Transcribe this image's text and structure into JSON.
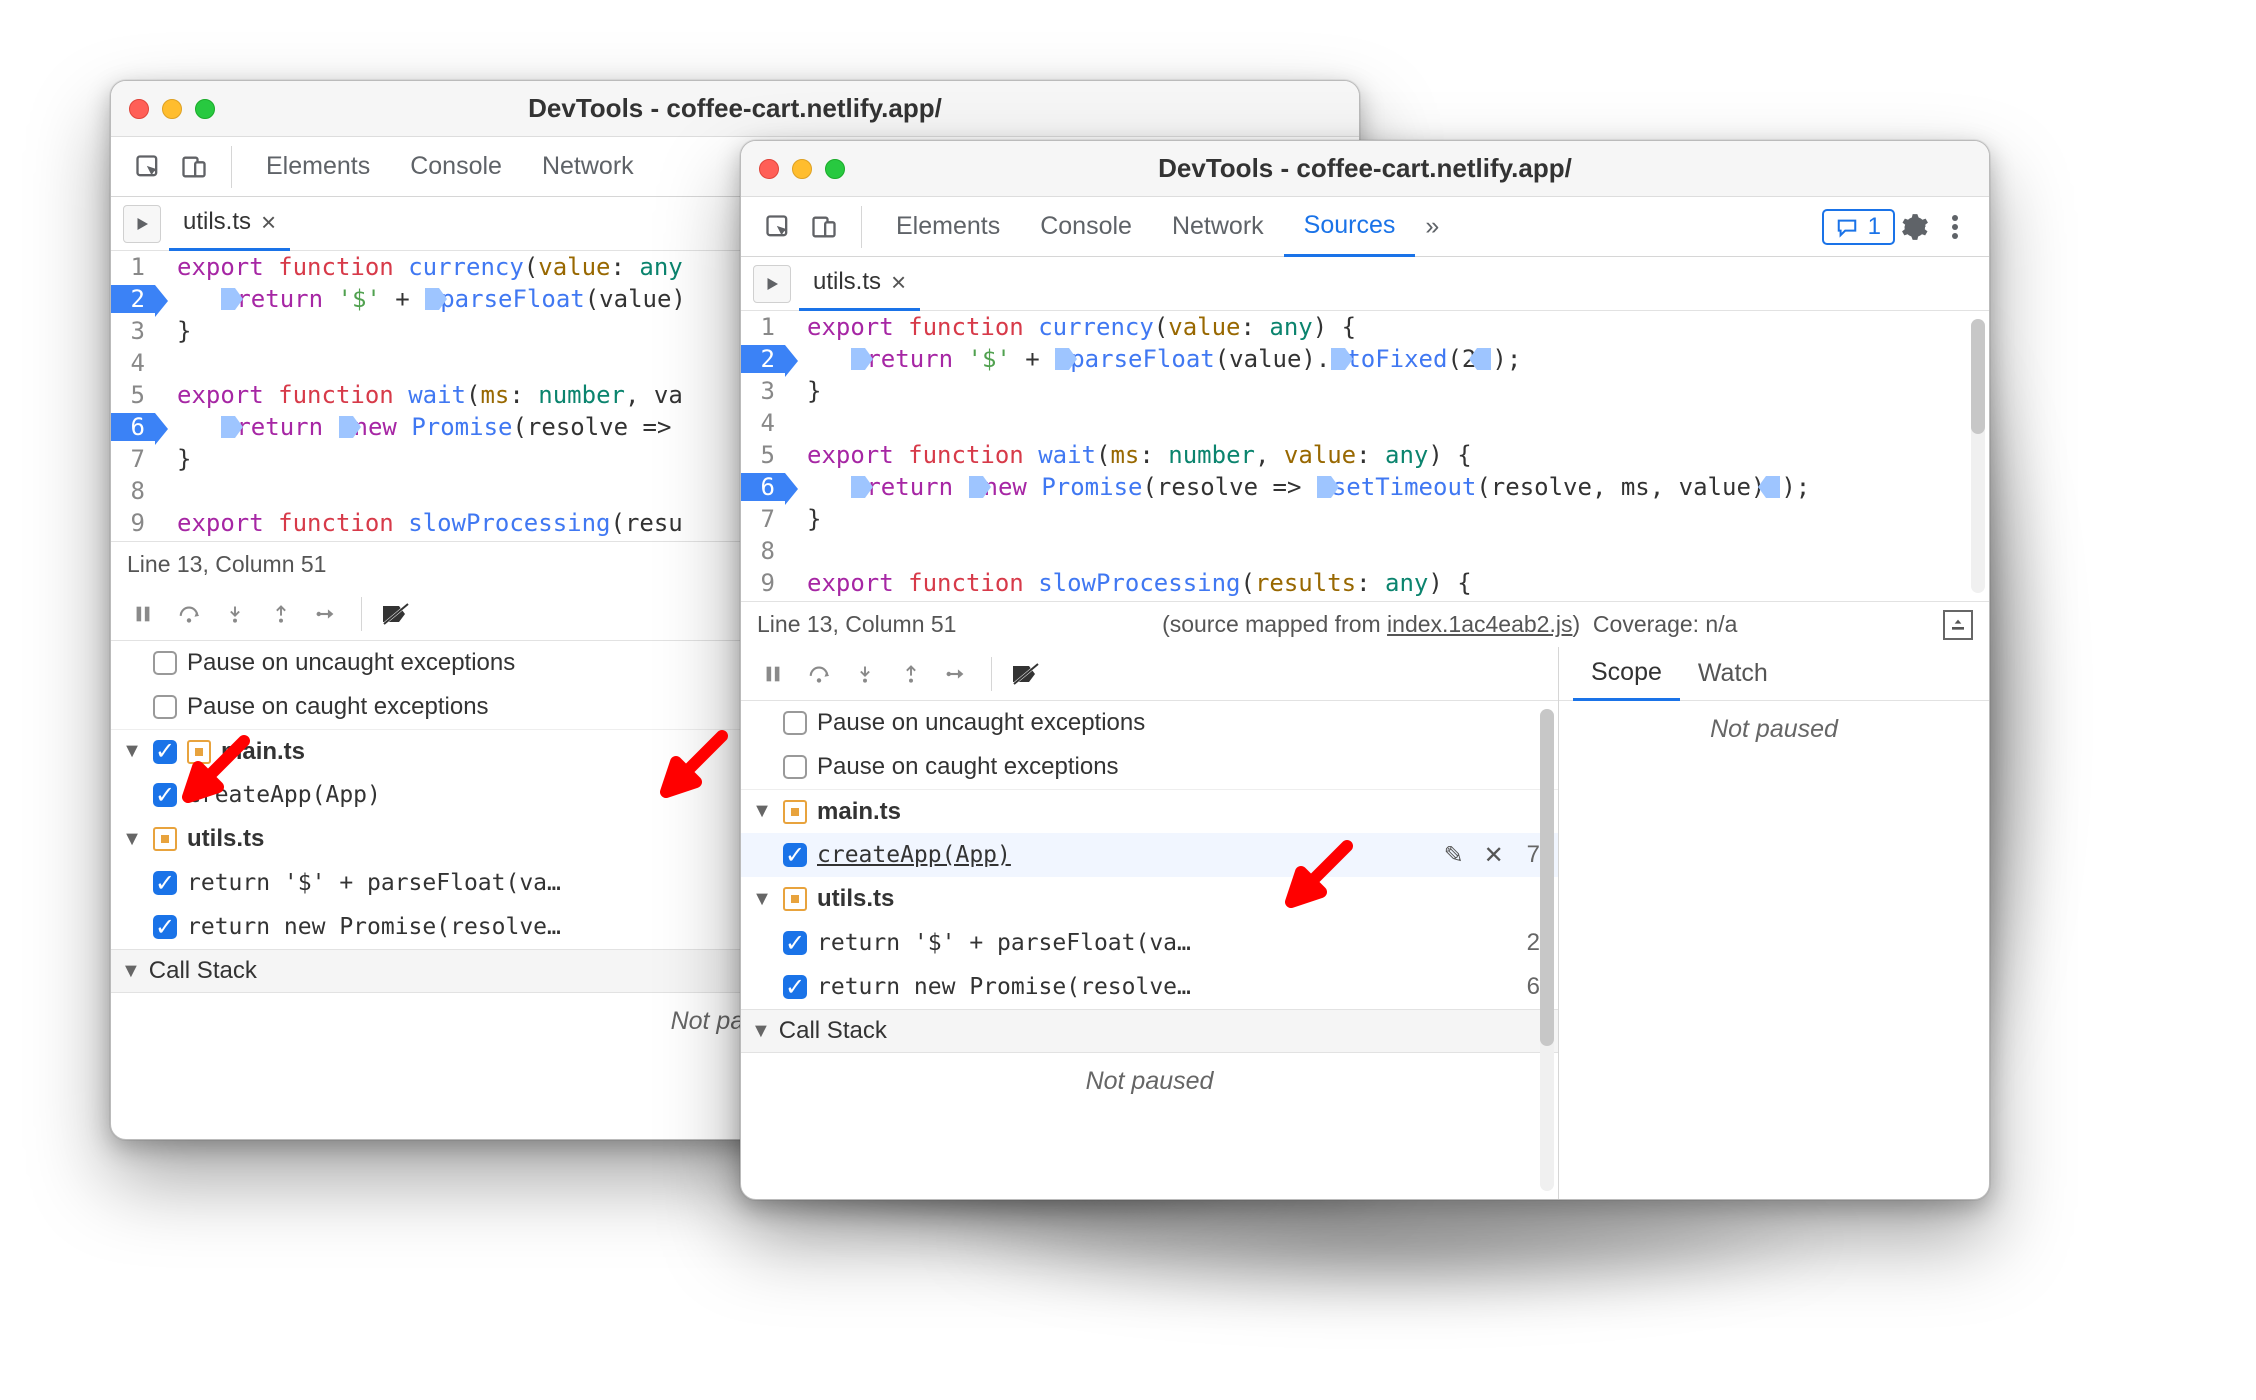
{
  "title": "DevTools - coffee-cart.netlify.app/",
  "tabs": [
    "Elements",
    "Console",
    "Network",
    "Sources"
  ],
  "issues_count": "1",
  "file_tab": "utils.ts",
  "status": {
    "pos": "Line 13, Column 51",
    "mapped_prefix": "(source mapped from ",
    "mapped_file": "index.1ac4eab2.js",
    "mapped_suffix": ")",
    "coverage": "Coverage: n/a",
    "mapped_short": "(source mapped"
  },
  "code": {
    "l1a": "export",
    "l1b": " function",
    "l1c": " currency",
    "l1d": "(",
    "l1e": "value",
    "l1f": ": ",
    "l1g": "any",
    "l1h": ") {",
    "l2a": "return",
    "l2b": " '$'",
    "l2c": " + ",
    "l2d": "parseFloat",
    "l2e": "(value).",
    "l2f": "toFixed",
    "l2g": "(",
    "l2h": "2",
    "l2i": ");",
    "l3": "}",
    "l5a": "export",
    "l5b": " function",
    "l5c": " wait",
    "l5d": "(",
    "l5e": "ms",
    "l5f": ": ",
    "l5g": "number",
    "l5h": ", ",
    "l5i": "value",
    "l5j": ": ",
    "l5k": "any",
    "l5l": ") {",
    "l6a": "return",
    "l6b": "new",
    "l6c": " Promise",
    "l6d": "(resolve => ",
    "l6e": "setTimeout",
    "l6f": "(resolve, ms, value)",
    "l6g": ");",
    "l7": "}",
    "l9a": "export",
    "l9b": " function",
    "l9c": " slowProcessing",
    "l9d": "(",
    "l9e": "results",
    "l9f": ": ",
    "l9g": "any",
    "l9h": ") {",
    "nums": {
      "n1": "1",
      "n2": "2",
      "n3": "3",
      "n4": "4",
      "n5": "5",
      "n6": "6",
      "n7": "7",
      "n8": "8",
      "n9": "9"
    },
    "l1_trunc": ") {",
    "l1_trunc2": "any",
    "l2_trunc": "(value)",
    "l5_trunc": ", va",
    "l9_trunc": "(resu"
  },
  "debugger": {
    "pause_uncaught": "Pause on uncaught exceptions",
    "pause_caught": "Pause on caught exceptions",
    "main_ts": "main.ts",
    "createApp": "createApp(App)",
    "createApp_line": "7",
    "utils_ts": "utils.ts",
    "bp1": "return '$' + parseFloat(va…",
    "bp1_line": "2",
    "bp2": "return new Promise(resolve…",
    "bp2_line": "6",
    "callstack": "Call Stack",
    "not_paused": "Not paused",
    "scope": "Scope",
    "watch": "Watch"
  }
}
